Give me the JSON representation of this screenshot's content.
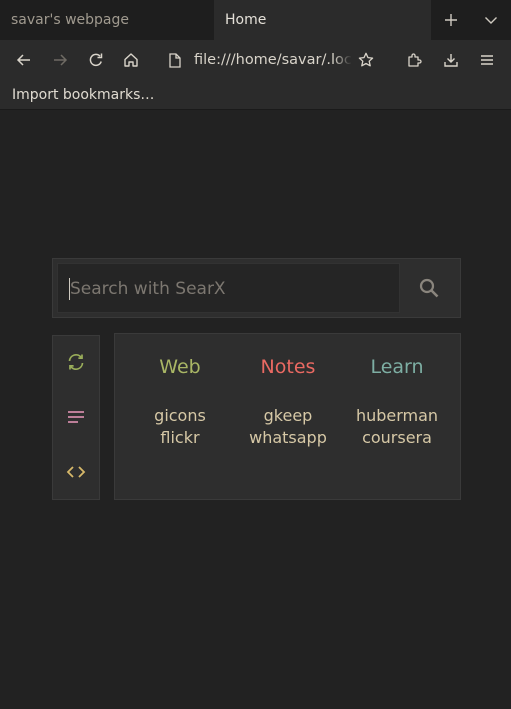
{
  "browser": {
    "tabs": [
      {
        "title": "savar's webpage",
        "active": false
      },
      {
        "title": "Home",
        "active": true
      }
    ],
    "tab_actions": {
      "new_tab_icon": "plus-icon",
      "list_tabs_icon": "chevron-down-icon"
    },
    "toolbar": {
      "back_icon": "arrow-left-icon",
      "forward_icon": "arrow-right-icon",
      "reload_icon": "reload-icon",
      "home_icon": "home-icon",
      "page_icon": "page-icon",
      "url": "file:///home/savar/.local/",
      "bookmark_icon": "star-icon",
      "extensions_icon": "puzzle-icon",
      "downloads_icon": "download-icon",
      "menu_icon": "hamburger-icon"
    },
    "bookmarks_bar": {
      "items": [
        "Import bookmarks…"
      ]
    }
  },
  "page": {
    "search": {
      "placeholder": "Search with SearX",
      "button_icon": "search-icon"
    },
    "side_buttons": [
      {
        "icon": "refresh-icon",
        "color": "#9aae5a"
      },
      {
        "icon": "lines-icon",
        "color": "#d08aa8"
      },
      {
        "icon": "code-icon",
        "color": "#d7b96a"
      }
    ],
    "columns": [
      {
        "title": "Web",
        "color": "#a9b665",
        "links": [
          "gicons",
          "flickr"
        ]
      },
      {
        "title": "Notes",
        "color": "#ea6962",
        "links": [
          "gkeep",
          "whatsapp"
        ]
      },
      {
        "title": "Learn",
        "color": "#7daea3",
        "links": [
          "huberman",
          "coursera"
        ]
      }
    ],
    "colors": {
      "background": "#222222",
      "panel": "#2e2e2e",
      "link": "#d6c8a6"
    }
  }
}
